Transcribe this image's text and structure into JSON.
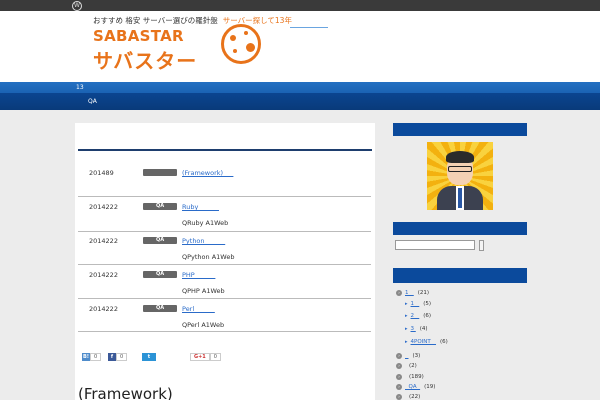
{
  "header": {
    "tagline": "おすすめ 格安 サーバー選びの羅針盤",
    "tagline_accent": "サーバー探して13年",
    "brand_en": "SABASTAR",
    "brand_jp": "サバスター"
  },
  "nav": {
    "item_1": "13",
    "item_2": "QA"
  },
  "entries": [
    {
      "date": "201489",
      "badge": "",
      "title": "(Framework)     ",
      "desc": ""
    },
    {
      "date": "2014222",
      "badge": "QA",
      "title": "Ruby          ",
      "desc": "QRuby A1Web"
    },
    {
      "date": "2014222",
      "badge": "QA",
      "title": "Python          ",
      "desc": "QPython A1Web"
    },
    {
      "date": "2014222",
      "badge": "QA",
      "title": "PHP          ",
      "desc": "QPHP A1Web"
    },
    {
      "date": "2014222",
      "badge": "QA",
      "title": "Perl          ",
      "desc": "QPerl A1Web"
    }
  ],
  "share": {
    "hatena_count": "0",
    "facebook_count": "0",
    "google_label": "G+1",
    "google_count": "0"
  },
  "post_heading": "(Framework)",
  "sidebar": {
    "categories": [
      {
        "arrow": false,
        "label": "1   ",
        "count": "(21)"
      },
      {
        "arrow": true,
        "label": "1   ",
        "count": "(5)"
      },
      {
        "arrow": true,
        "label": "2   ",
        "count": "(6)"
      },
      {
        "arrow": true,
        "label": "3 ",
        "count": "(4)"
      },
      {
        "arrow": true,
        "label": "4POINT   ",
        "count": "(6)"
      },
      {
        "arrow": false,
        "label": "  ",
        "count": "(3)"
      },
      {
        "arrow": false,
        "label": "",
        "count": "(2)"
      },
      {
        "arrow": false,
        "label": "",
        "count": "(189)"
      },
      {
        "arrow": false,
        "label": "  QA  ",
        "count": "(19)"
      },
      {
        "arrow": false,
        "label": "",
        "count": "(22)"
      }
    ]
  }
}
